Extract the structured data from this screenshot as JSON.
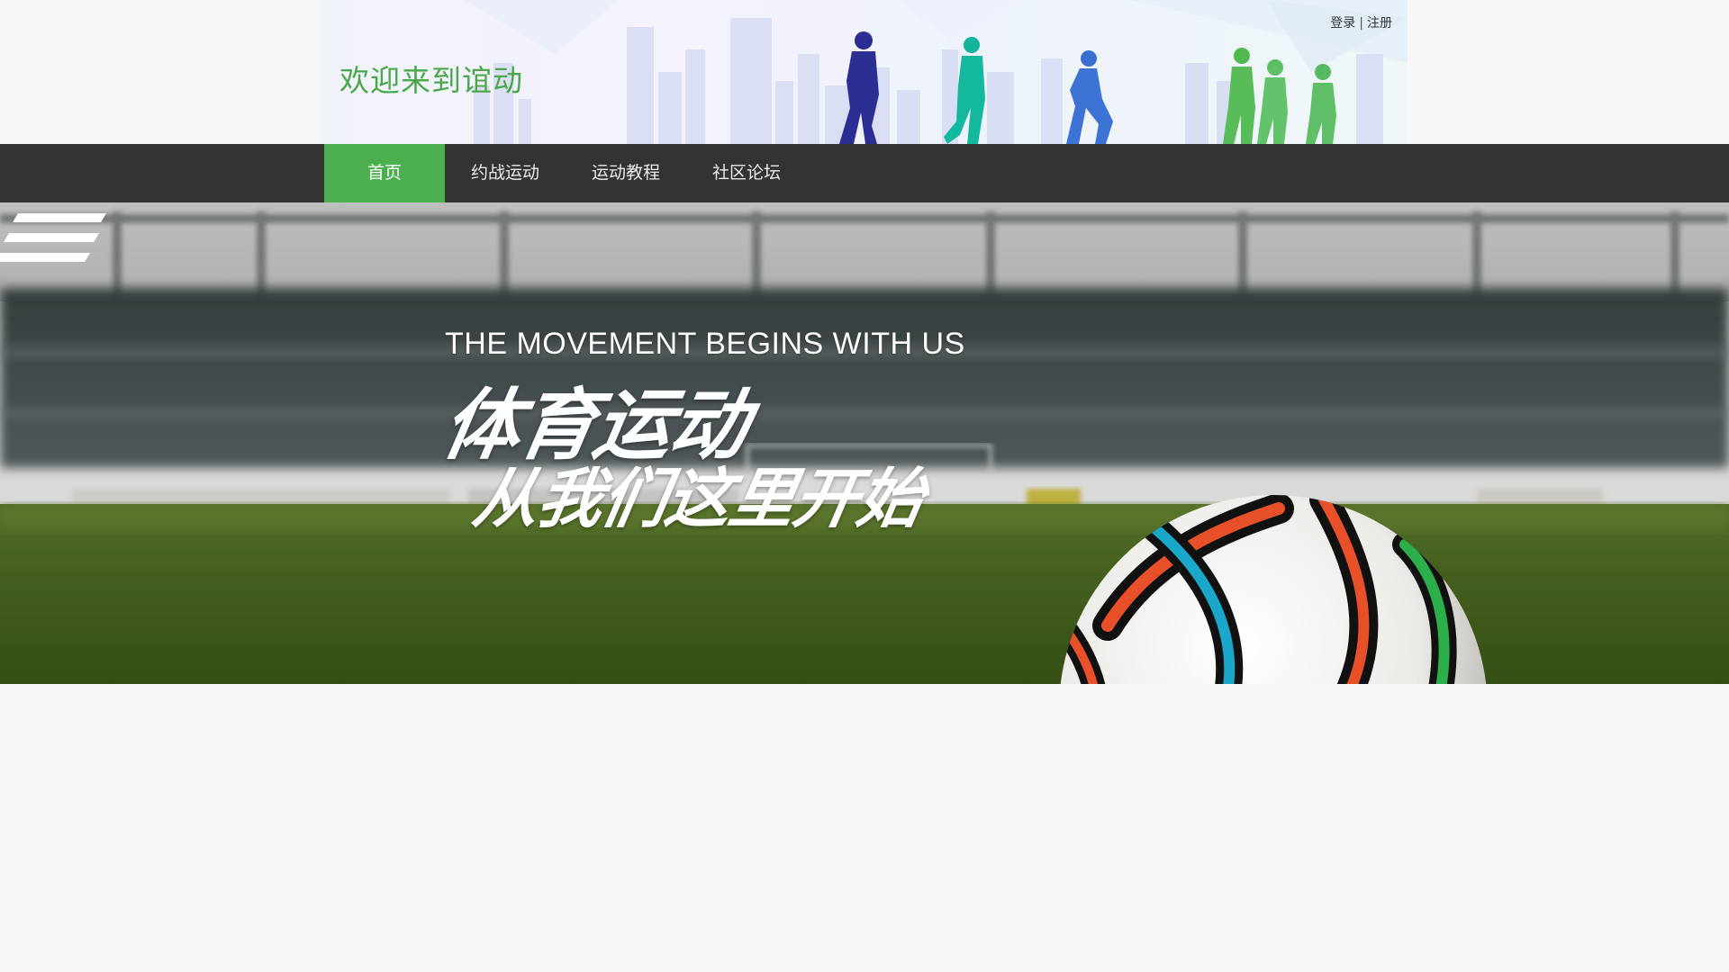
{
  "header": {
    "welcome_text": "欢迎来到谊动",
    "auth": {
      "login": "登录",
      "separator": "|",
      "register": "注册"
    }
  },
  "nav": {
    "items": [
      {
        "label": "首页",
        "active": true
      },
      {
        "label": "约战运动",
        "active": false
      },
      {
        "label": "运动教程",
        "active": false
      },
      {
        "label": "社区论坛",
        "active": false
      }
    ]
  },
  "hero": {
    "title_en": "THE MOVEMENT BEGINS WITH US",
    "title_cn_line1": "体育运动",
    "title_cn_line2": "从我们这里开始"
  },
  "colors": {
    "brand_green": "#4caf50",
    "welcome_green": "#4aa84a",
    "nav_bg": "#333333",
    "page_bg": "#f7f7f7"
  }
}
